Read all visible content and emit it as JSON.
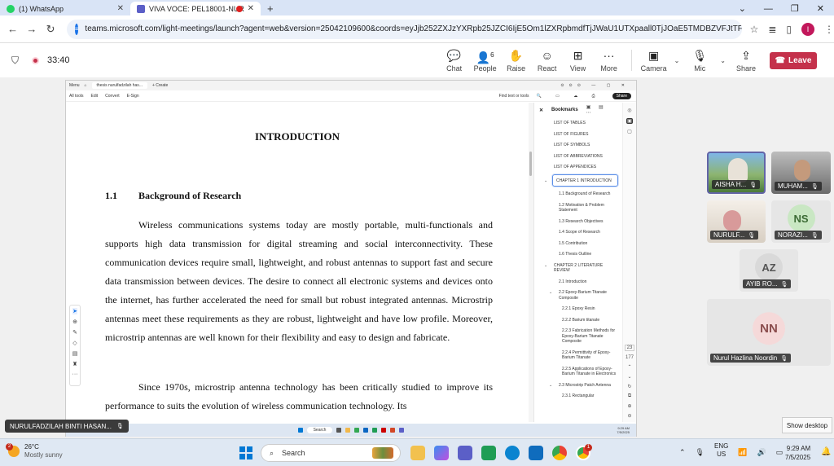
{
  "browser": {
    "tabs": [
      {
        "label": "(1) WhatsApp",
        "icon": "whatsapp-icon"
      },
      {
        "label": "VIVA VOCE: PEL18001-NUR",
        "icon": "teams-icon"
      }
    ],
    "url": "teams.microsoft.com/light-meetings/launch?agent=web&version=25042109600&coords=eyJjb252ZXJzYXRpb25JZCI6IjE5Om1lZXRpbmdfTjJWaU1UTXpaall0TjJOaE5TMDBZVFJtTFdFek9HVXRNalU",
    "profile_initial": "I"
  },
  "teams": {
    "timer": "33:40",
    "people_count": "6",
    "buttons": {
      "chat": "Chat",
      "people": "People",
      "raise": "Raise",
      "react": "React",
      "view": "View",
      "more": "More",
      "camera": "Camera",
      "mic": "Mic",
      "share": "Share",
      "leave": "Leave"
    },
    "presenter_name": "NURULFADZILAH BINTI HASAN...",
    "participants": [
      {
        "name": "AISHA H...",
        "initials": ""
      },
      {
        "name": "MUHAM...",
        "initials": ""
      },
      {
        "name": "NURULF...",
        "initials": ""
      },
      {
        "name": "NORAZI...",
        "initials": "NS"
      },
      {
        "name": "AYIB RO...",
        "initials": "AZ"
      },
      {
        "name": "Nurul Hazlina Noordin",
        "initials": "NN"
      }
    ],
    "show_desktop": "Show desktop"
  },
  "acrobat": {
    "tab_menu": "Menu",
    "tab_file": "thesis nurulfadzilah has...",
    "tab_create": "+ Create",
    "tools": [
      "All tools",
      "Edit",
      "Convert",
      "E-Sign"
    ],
    "find": "Find text or tools",
    "share": "Share",
    "bookmarks_title": "Bookmarks",
    "page_current": "23",
    "page_total": "177",
    "bookmarks": [
      {
        "label": "LIST OF TABLES",
        "level": 1
      },
      {
        "label": "LIST OF FIGURES",
        "level": 1
      },
      {
        "label": "LIST OF SYMBOLS",
        "level": 1
      },
      {
        "label": "LIST OF ABBREVIATIONS",
        "level": 1
      },
      {
        "label": "LIST OF APPENDICES",
        "level": 1
      },
      {
        "label": "CHAPTER 1 INTRODUCTION",
        "level": 1,
        "selected": true
      },
      {
        "label": "1.1 Background of Research",
        "level": 2
      },
      {
        "label": "1.2 Motivation & Problem Statement",
        "level": 2
      },
      {
        "label": "1.3 Research Objectives",
        "level": 2
      },
      {
        "label": "1.4 Scope of Research",
        "level": 2
      },
      {
        "label": "1.5 Contribution",
        "level": 2
      },
      {
        "label": "1.6 Thesis Outline",
        "level": 2
      },
      {
        "label": "CHAPTER 2 LITERATURE REVIEW",
        "level": 1
      },
      {
        "label": "2.1 Introduction",
        "level": 2
      },
      {
        "label": "2.2 Epoxy-Barium Titanate Composite",
        "level": 2
      },
      {
        "label": "2.2.1 Epoxy Resin",
        "level": 3
      },
      {
        "label": "2.2.2 Barium titanate",
        "level": 3
      },
      {
        "label": "2.2.3 Fabrication Methods for Epoxy-Barium Titanate Composite",
        "level": 3
      },
      {
        "label": "2.2.4 Permittivity of Epoxy-Barium Titanate",
        "level": 3
      },
      {
        "label": "2.2.5 Applications of Epoxy-Barium Titanate in Electronics",
        "level": 3
      },
      {
        "label": "2.3 Microstrip Patch Antenna",
        "level": 2
      },
      {
        "label": "2.3.1 Rectangular",
        "level": 3
      }
    ],
    "taskbar_search": "Search",
    "taskbar_time": "9:29 AM",
    "taskbar_date": "7/5/2025"
  },
  "document": {
    "title": "INTRODUCTION",
    "section_number": "1.1",
    "section_title": "Background of Research",
    "para1": "Wireless communications systems today are mostly portable, multi-functionals and supports high data transmission for digital streaming and social interconnectivity. These communication devices require small, lightweight, and robust antennas to support fast and secure data transmission between devices. The desire to connect all electronic systems and devices onto the internet, has further accelerated the need for small but robust integrated antennas. Microstrip antennas meet these requirements as they are robust, lightweight and have low profile. Moreover, microstrip antennas are well known for their flexibility and easy to design and fabricate.",
    "para2": "Since 1970s, microstrip antenna technology has been critically studied to improve its performance to suits the evolution of wireless communication technology. Its"
  },
  "windows": {
    "notification_count": "2",
    "temperature": "26°C",
    "weather": "Mostly sunny",
    "search": "Search",
    "lang_top": "ENG",
    "lang_bottom": "US",
    "time": "9:29 AM",
    "date": "7/5/2025",
    "chrome_badge": "1"
  },
  "colors": {
    "leave": "#c4314b",
    "teams_accent": "#5b5fc7",
    "active_tile_border": "#6264a7"
  }
}
